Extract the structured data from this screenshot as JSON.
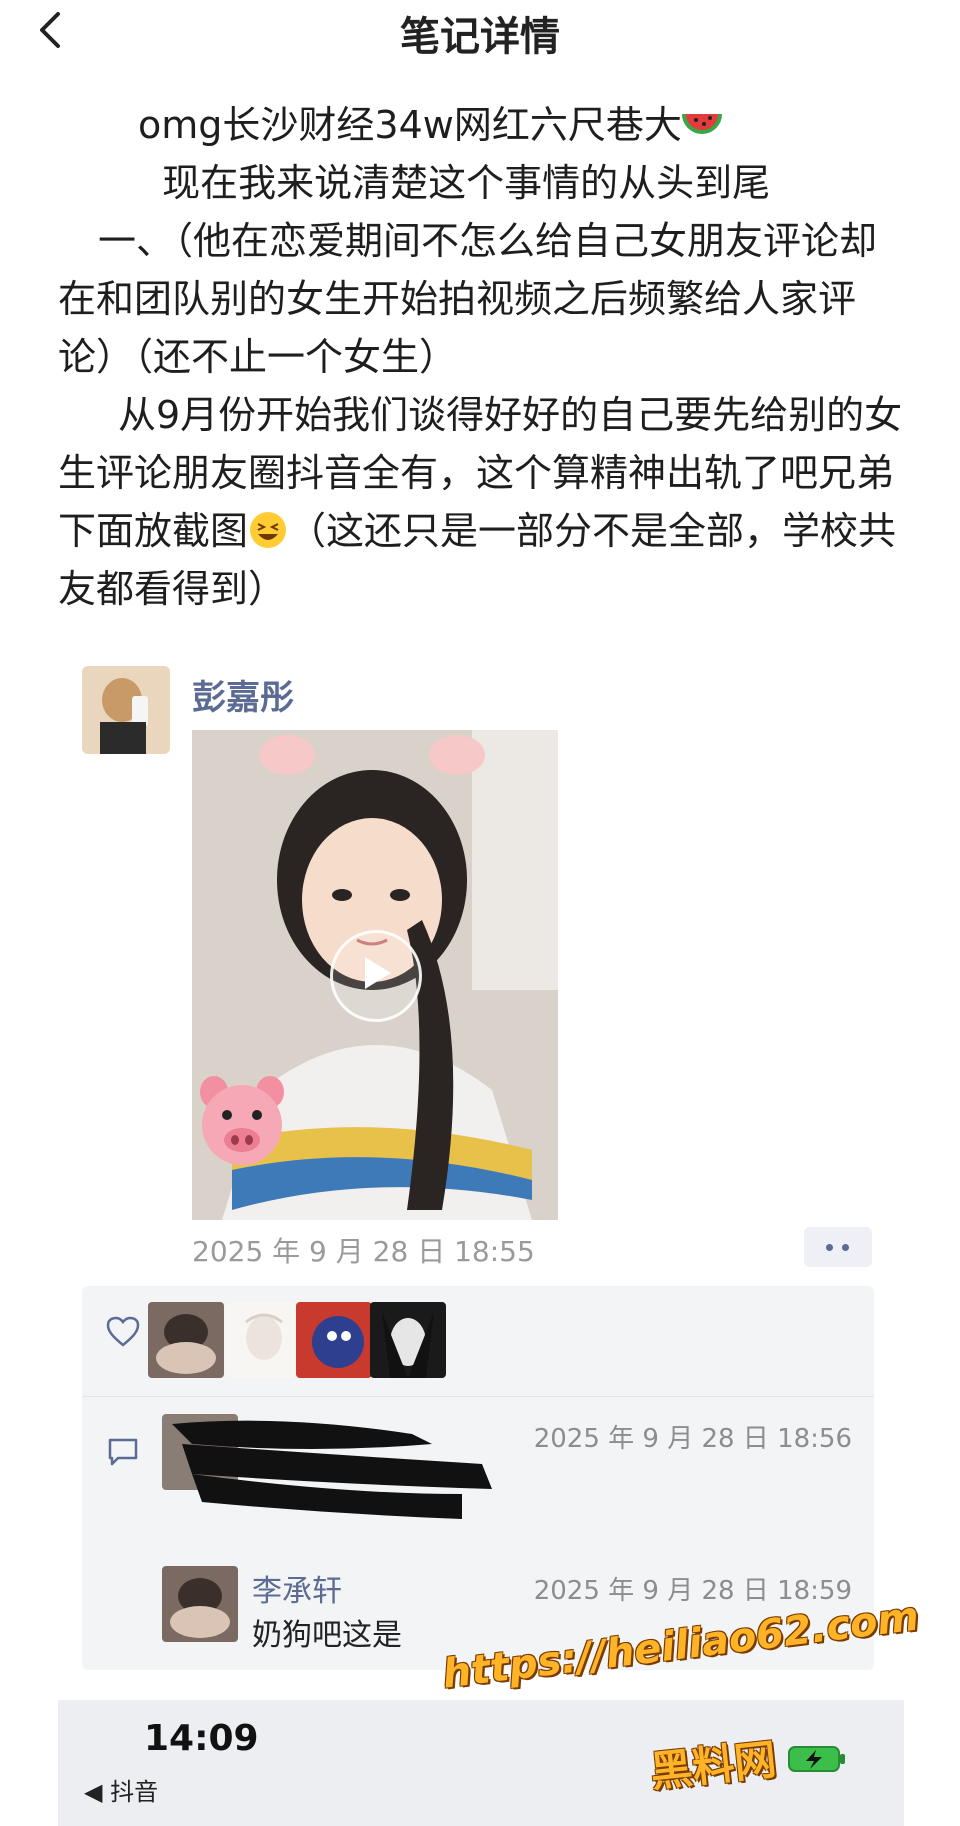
{
  "header": {
    "title": "笔记详情",
    "back_icon": "chevron-left-icon"
  },
  "post": {
    "lines": [
      "omg长沙财经34w网红六尺巷大",
      "  现在我来说清楚这个事情的从头到尾",
      "  一、（他在恋爱期间不怎么给自己女朋友评论却在和团队别的女生开始拍视频之后频繁给人家评论）（还不止一个女生）",
      "    从9月份开始我们谈得好好的自己要先给别的女生评论朋友圈抖音全有，这个算精神出轨了吧兄弟下面放截图",
      "（这还只是一部分不是全部，学校共友都看得到）"
    ],
    "emoji_1": "watermelon",
    "emoji_2": "laughing-face"
  },
  "moment": {
    "poster_name": "彭嘉彤",
    "video_label": "play-icon",
    "time": "2025 年 9 月 28 日 18:55",
    "more_label": "••",
    "likes_icon": "heart-icon",
    "comments_icon": "comment-icon",
    "comments": [
      {
        "name": "",
        "time": "2025 年 9 月 28 日 18:56",
        "text": ""
      },
      {
        "name": "李承轩",
        "time": "2025 年 9 月 28 日 18:59",
        "text": "奶狗吧这是"
      }
    ]
  },
  "statusbar": {
    "time": "14:09",
    "back_app": "◀ 抖音"
  },
  "watermark": {
    "url": "https://heiliao62.com",
    "name": "黑料网"
  },
  "colors": {
    "name_blue": "#5b6b93",
    "watermark_orange": "#ffb326"
  }
}
